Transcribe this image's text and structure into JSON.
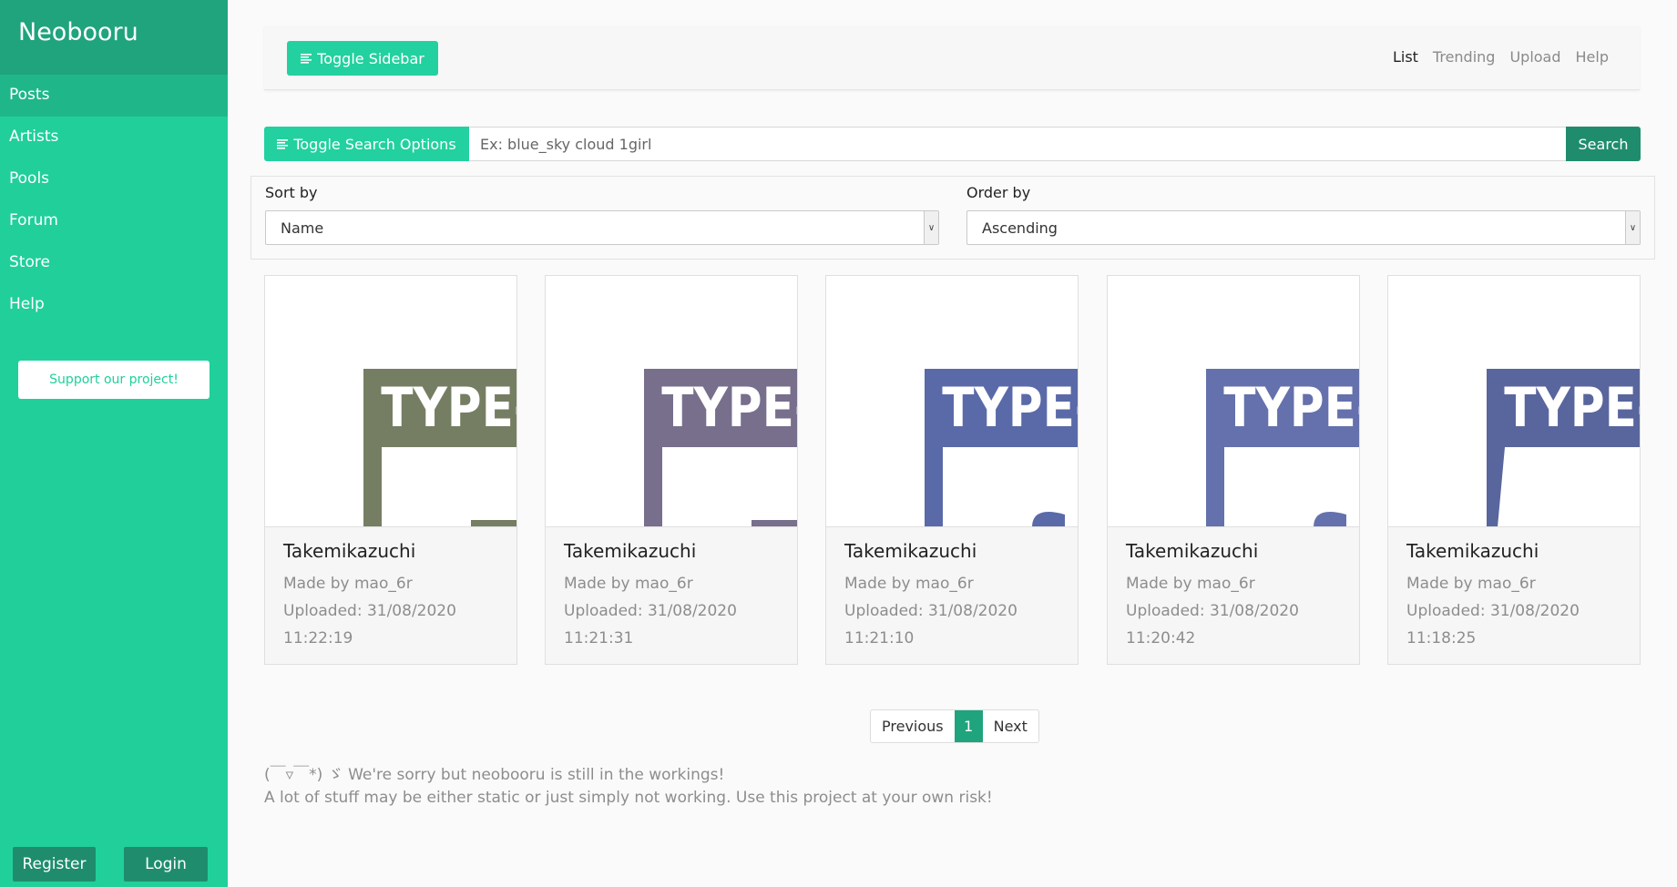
{
  "sidebar": {
    "brand": "Neobooru",
    "items": [
      {
        "label": "Posts"
      },
      {
        "label": "Artists"
      },
      {
        "label": "Pools"
      },
      {
        "label": "Forum"
      },
      {
        "label": "Store"
      },
      {
        "label": "Help"
      }
    ],
    "support_label": "Support our project!",
    "register_label": "Register",
    "login_label": "Login"
  },
  "topbar": {
    "toggle_sidebar_label": "Toggle Sidebar",
    "links": [
      {
        "label": "List"
      },
      {
        "label": "Trending"
      },
      {
        "label": "Upload"
      },
      {
        "label": "Help"
      }
    ]
  },
  "search": {
    "toggle_label": "Toggle Search Options",
    "placeholder": "Ex: blue_sky cloud 1girl",
    "button_label": "Search"
  },
  "options": {
    "sort_label": "Sort by",
    "sort_value": "Name",
    "order_label": "Order by",
    "order_value": "Ascending"
  },
  "posts": [
    {
      "title": "Takemikazuchi",
      "author": "Made by mao_6r",
      "uploaded": "Uploaded: 31/08/2020",
      "time": "11:22:19",
      "color": "#757e63",
      "thumb_text": "TYPE-"
    },
    {
      "title": "Takemikazuchi",
      "author": "Made by mao_6r",
      "uploaded": "Uploaded: 31/08/2020",
      "time": "11:21:31",
      "color": "#776f8c",
      "thumb_text": "TYPE-"
    },
    {
      "title": "Takemikazuchi",
      "author": "Made by mao_6r",
      "uploaded": "Uploaded: 31/08/2020",
      "time": "11:21:10",
      "color": "#5a6aa8",
      "thumb_text": "TYPE-"
    },
    {
      "title": "Takemikazuchi",
      "author": "Made by mao_6r",
      "uploaded": "Uploaded: 31/08/2020",
      "time": "11:20:42",
      "color": "#6471ac",
      "thumb_text": "TYPE-"
    },
    {
      "title": "Takemikazuchi",
      "author": "Made by mao_6r",
      "uploaded": "Uploaded: 31/08/2020",
      "time": "11:18:25",
      "color": "#59669d",
      "thumb_text": "TYPE-"
    }
  ],
  "pagination": {
    "previous": "Previous",
    "current": "1",
    "next": "Next"
  },
  "notice": {
    "line1": "(￣▿￣*) ゞ We're sorry but neobooru is still in the workings!",
    "line2": "A lot of stuff may be either static or just simply not working. Use this project at your own risk!"
  },
  "colors": {
    "accent": "#21cf9b",
    "accent_dark": "#1f8d6d",
    "brand_bg": "#1fa47d"
  }
}
